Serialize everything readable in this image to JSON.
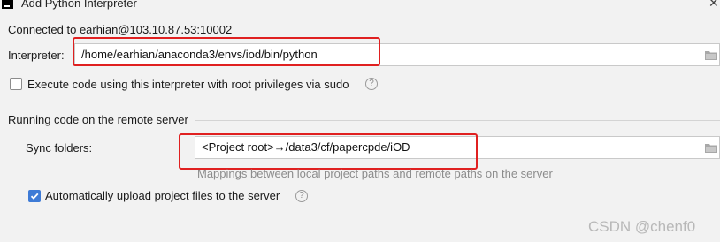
{
  "window": {
    "title": "Add Python Interpreter",
    "close_glyph": "✕"
  },
  "connection": {
    "status_text": "Connected to earhian@103.10.87.53:10002"
  },
  "interpreter": {
    "label": "Interpreter:",
    "value": "/home/earhian/anaconda3/envs/iod/bin/python"
  },
  "sudo_option": {
    "label": "Execute code using this interpreter with root privileges via sudo",
    "checked": false
  },
  "remote_section": {
    "heading": "Running code on the remote server"
  },
  "sync": {
    "label": "Sync folders:",
    "value": "<Project root>→/data3/cf/papercpde/iOD",
    "hint": "Mappings between local project paths and remote paths on the server"
  },
  "auto_upload": {
    "label": "Automatically upload project files to the server",
    "checked": true
  },
  "help_glyph": "?",
  "watermark": "CSDN @chenf0",
  "colors": {
    "highlight": "#e02020",
    "checkbox_checked": "#3e7bd6"
  }
}
